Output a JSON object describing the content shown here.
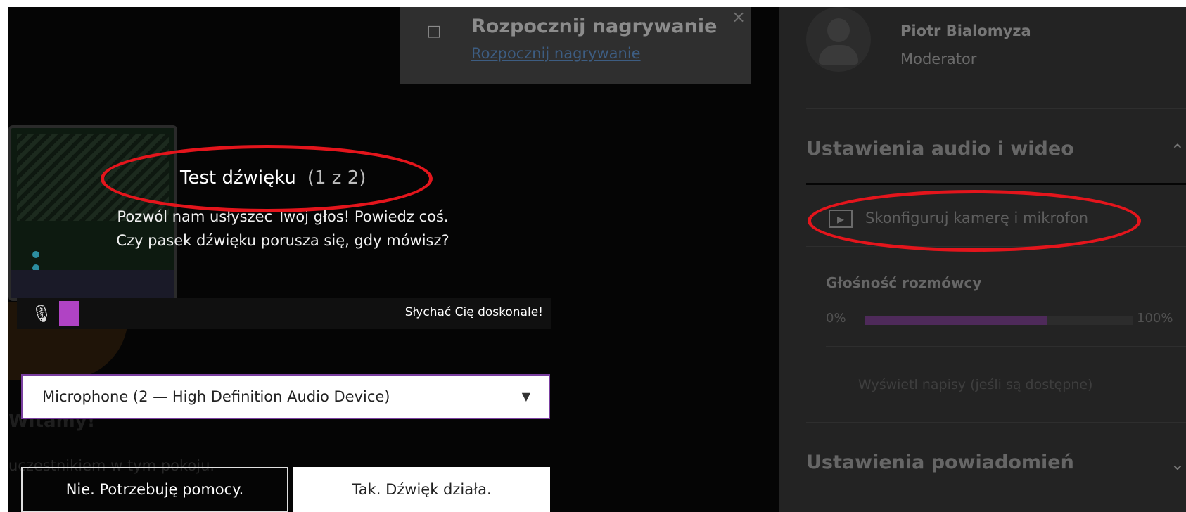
{
  "recording": {
    "title": "Rozpocznij nagrywanie",
    "link": "Rozpocznij nagrywanie",
    "close": "×"
  },
  "audio_test": {
    "title": "Test dźwięku",
    "step": "(1 z 2)",
    "line1": "Pozwól nam usłyszeć Twój głos! Powiedz coś.",
    "line2": "Czy pasek dźwięku porusza się, gdy mówisz?",
    "meter_status": "Słychać Cię doskonale!",
    "meter_level": 0.04,
    "microphone_selected": "Microphone (2 — High Definition Audio Device)",
    "btn_no": "Nie. Potrzebuję pomocy.",
    "btn_yes": "Tak. Dźwięk działa."
  },
  "background": {
    "welcome": "Witamy!",
    "sub": "uczestnikiem w tym pokoju."
  },
  "sidebar": {
    "user_name": "Piotr Bialomyza",
    "user_role": "Moderator",
    "av_section": "Ustawienia audio i wideo",
    "configure": "Skonfiguruj kamerę i mikrofon",
    "volume_label": "Głośność rozmówcy",
    "volume_min": "0%",
    "volume_max": "100%",
    "volume_level": 0.68,
    "captions": "Wyświetl napisy (jeśli są dostępne)",
    "notif_section": "Ustawienia powiadomień"
  },
  "colors": {
    "accent": "#b043c4",
    "highlight": "#e4151c"
  },
  "icons": {
    "camera": "camera-icon",
    "close": "close-icon",
    "microphone": "microphone-icon",
    "caret": "caret-down-icon",
    "avatar": "avatar-icon",
    "chevron_up": "chevron-up-icon",
    "chevron_down": "chevron-down-icon",
    "camera_mic": "camera-mic-icon"
  }
}
